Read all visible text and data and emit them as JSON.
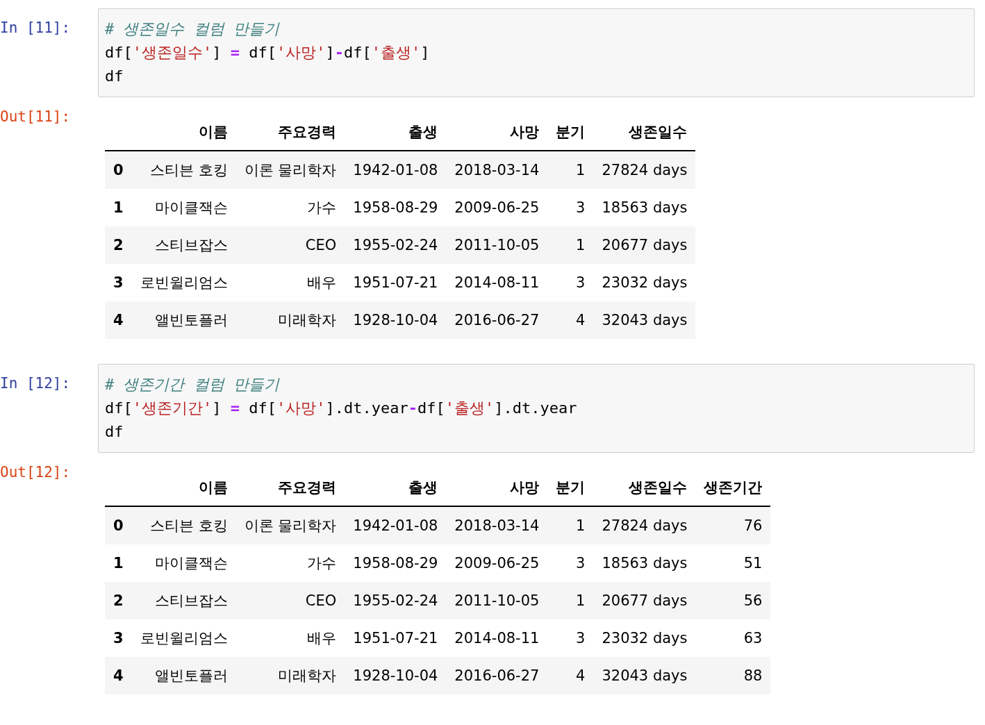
{
  "cells": [
    {
      "in_prompt": "In [11]:",
      "code": [
        [
          {
            "kind": "comment",
            "text": "# 생존일수 컬럼 만들기"
          }
        ],
        [
          {
            "kind": "name",
            "text": "df"
          },
          {
            "kind": "punct",
            "text": "["
          },
          {
            "kind": "string",
            "text": "'생존일수'"
          },
          {
            "kind": "punct",
            "text": "] "
          },
          {
            "kind": "operator",
            "text": "="
          },
          {
            "kind": "name",
            "text": " df"
          },
          {
            "kind": "punct",
            "text": "["
          },
          {
            "kind": "string",
            "text": "'사망'"
          },
          {
            "kind": "punct",
            "text": "]"
          },
          {
            "kind": "operator",
            "text": "-"
          },
          {
            "kind": "name",
            "text": "df"
          },
          {
            "kind": "punct",
            "text": "["
          },
          {
            "kind": "string",
            "text": "'출생'"
          },
          {
            "kind": "punct",
            "text": "]"
          }
        ],
        [
          {
            "kind": "name",
            "text": "df"
          }
        ]
      ],
      "out_prompt": "Out[11]:",
      "table": {
        "columns": [
          "",
          "이름",
          "주요경력",
          "출생",
          "사망",
          "분기",
          "생존일수"
        ],
        "rows": [
          [
            "0",
            "스티븐 호킹",
            "이론 물리학자",
            "1942-01-08",
            "2018-03-14",
            "1",
            "27824 days"
          ],
          [
            "1",
            "마이클잭슨",
            "가수",
            "1958-08-29",
            "2009-06-25",
            "3",
            "18563 days"
          ],
          [
            "2",
            "스티브잡스",
            "CEO",
            "1955-02-24",
            "2011-10-05",
            "1",
            "20677 days"
          ],
          [
            "3",
            "로빈윌리엄스",
            "배우",
            "1951-07-21",
            "2014-08-11",
            "3",
            "23032 days"
          ],
          [
            "4",
            "앨빈토플러",
            "미래학자",
            "1928-10-04",
            "2016-06-27",
            "4",
            "32043 days"
          ]
        ]
      }
    },
    {
      "in_prompt": "In [12]:",
      "code": [
        [
          {
            "kind": "comment",
            "text": "# 생존기간 컬럼 만들기"
          }
        ],
        [
          {
            "kind": "name",
            "text": "df"
          },
          {
            "kind": "punct",
            "text": "["
          },
          {
            "kind": "string",
            "text": "'생존기간'"
          },
          {
            "kind": "punct",
            "text": "] "
          },
          {
            "kind": "operator",
            "text": "="
          },
          {
            "kind": "name",
            "text": " df"
          },
          {
            "kind": "punct",
            "text": "["
          },
          {
            "kind": "string",
            "text": "'사망'"
          },
          {
            "kind": "punct",
            "text": "].dt.year"
          },
          {
            "kind": "operator",
            "text": "-"
          },
          {
            "kind": "name",
            "text": "df"
          },
          {
            "kind": "punct",
            "text": "["
          },
          {
            "kind": "string",
            "text": "'출생'"
          },
          {
            "kind": "punct",
            "text": "].dt.year"
          }
        ],
        [
          {
            "kind": "name",
            "text": "df"
          }
        ]
      ],
      "out_prompt": "Out[12]:",
      "table": {
        "columns": [
          "",
          "이름",
          "주요경력",
          "출생",
          "사망",
          "분기",
          "생존일수",
          "생존기간"
        ],
        "rows": [
          [
            "0",
            "스티븐 호킹",
            "이론 물리학자",
            "1942-01-08",
            "2018-03-14",
            "1",
            "27824 days",
            "76"
          ],
          [
            "1",
            "마이클잭슨",
            "가수",
            "1958-08-29",
            "2009-06-25",
            "3",
            "18563 days",
            "51"
          ],
          [
            "2",
            "스티브잡스",
            "CEO",
            "1955-02-24",
            "2011-10-05",
            "1",
            "20677 days",
            "56"
          ],
          [
            "3",
            "로빈윌리엄스",
            "배우",
            "1951-07-21",
            "2014-08-11",
            "3",
            "23032 days",
            "63"
          ],
          [
            "4",
            "앨빈토플러",
            "미래학자",
            "1928-10-04",
            "2016-06-27",
            "4",
            "32043 days",
            "88"
          ]
        ]
      }
    }
  ]
}
